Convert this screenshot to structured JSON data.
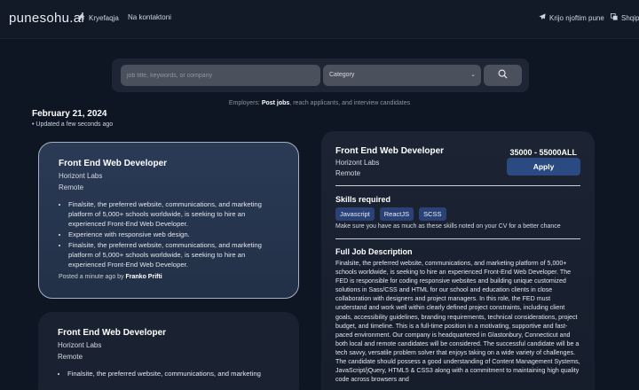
{
  "nav": {
    "logo": "punesohu.al",
    "home_label": "Kryefaqja",
    "contact_label": "Na kontaktoni",
    "post_job_label": "Krijo njoftim pune",
    "language_label": "Shqip"
  },
  "search": {
    "placeholder": "job title, keywords, or company",
    "category_label": "Category"
  },
  "employers": {
    "prefix": "Employers:",
    "link": "Post jobs",
    "suffix": ", reach applicants, and interview candidates"
  },
  "listing": {
    "date": "February 21, 2024",
    "updated": "• Updated a few seconds ago"
  },
  "cards": [
    {
      "title": "Front End Web Developer",
      "company": "Horizont Labs",
      "location": "Remote",
      "bullets": [
        "Finalsite, the preferred website, communications, and marketing platform of 5,000+ schools worldwide, is seeking to hire an experienced Front-End Web Developer.",
        "Experience with responsive web design.",
        "Finalsite, the preferred website, communications, and marketing platform of 5,000+ schools worldwide, is seeking to hire an experienced Front-End Web Developer."
      ],
      "posted_prefix": "Posted a minute ago by",
      "posted_by": "Franko Prifti"
    },
    {
      "title": "Front End Web Developer",
      "company": "Horizont Labs",
      "location": "Remote",
      "bullets": [
        "Finalsite, the preferred website, communications, and marketing"
      ]
    }
  ],
  "detail": {
    "title": "Front End Web Developer",
    "company": "Horizont Labs",
    "location": "Remote",
    "salary": "35000 - 55000ALL",
    "apply_label": "Apply",
    "skills_heading": "Skills required",
    "skills": [
      "Javascript",
      "ReactJS",
      "SCSS"
    ],
    "skills_note": "Make sure you have as much as these skills noted on your CV for a better chance",
    "description_heading": "Full Job Description",
    "description": "Finalsite, the preferred website, communications, and marketing platform of 5,000+ schools worldwide, is seeking to hire an experienced Front-End Web Developer. The FED is responsible for coding responsive websites and building unique customized solutions in Sass/CSS and HTML for our school and education clients in close collaboration with designers and project managers. In this role, the FED must understand and work well within clearly defined project constraints, including client goals, accessibility guidelines, branding requirements, technical considerations, project budget, and timeline. This is a full-time position in a motivating, supportive and fast-paced environment. Our company is headquartered in Glastonbury, Connecticut and both local and remote candidates will be considered. The successful candidate will be a tech savvy, versatile problem solver that enjoys taking on a wide variety of challenges. The candidate should possess a good understanding of Content Management Systems, JavaScript/jQuery, HTML5 & CSS3 along with a commitment to maintaining high quality code across browsers and"
  }
}
